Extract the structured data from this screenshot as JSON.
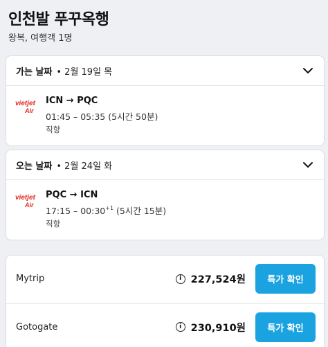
{
  "header": {
    "title": "인천발 푸꾸옥행",
    "subtitle": "왕복, 여행객 1명"
  },
  "outbound": {
    "label": "가는 날짜",
    "date": "• 2월 19일 목",
    "airline_logo_text": "vietjet Air",
    "route": "ICN → PQC",
    "times": "01:45 – 05:35",
    "next_day": "",
    "duration": "(5시간 50분)",
    "stops": "직항"
  },
  "inbound": {
    "label": "오는 날짜",
    "date": "• 2월 24일 화",
    "airline_logo_text": "vietjet Air",
    "route": "PQC → ICN",
    "times": "17:15 – 00:30",
    "next_day": "+1",
    "duration": "(5시간 15분)",
    "stops": "직항"
  },
  "offers": [
    {
      "provider": "Mytrip",
      "price": "227,524원",
      "button": "특가 확인"
    },
    {
      "provider": "Gotogate",
      "price": "230,910원",
      "button": "특가 확인"
    }
  ],
  "colors": {
    "button": "#1aa3e0",
    "logo_red": "#e2261c"
  },
  "icons": {
    "expand": "chevron-down-icon",
    "info": "info-icon",
    "airline": "vietjet-logo-icon"
  }
}
